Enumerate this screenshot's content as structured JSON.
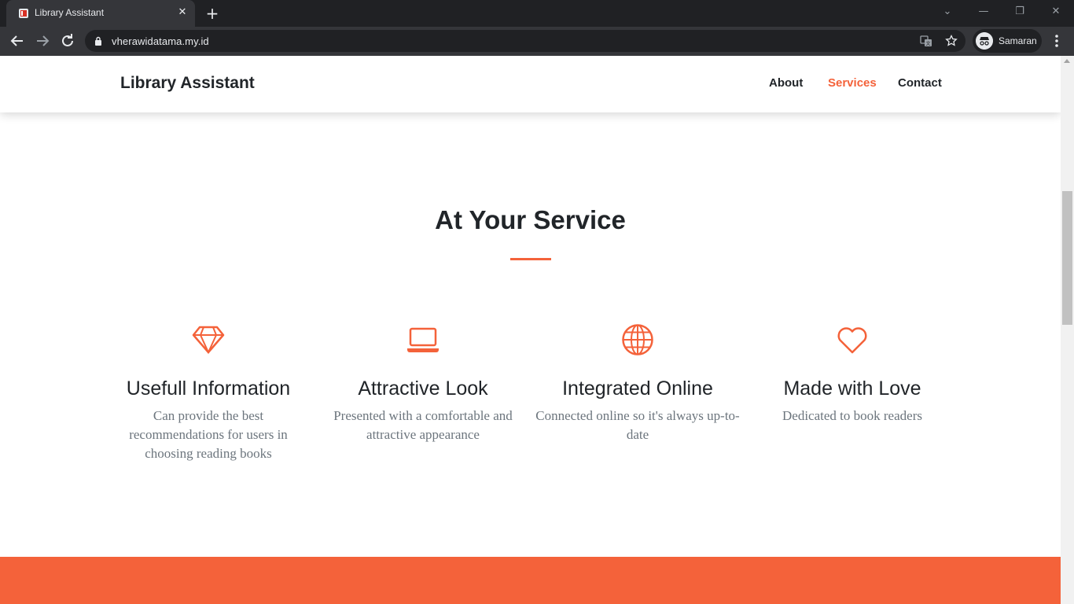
{
  "browser": {
    "tab_title": "Library Assistant",
    "tab_close": "✕",
    "new_tab": "+",
    "url": "vherawidatama.my.id",
    "profile_label": "Samaran",
    "window_controls": {
      "dropdown": "⌄",
      "minimize": "—",
      "restore": "❐",
      "close": "✕"
    }
  },
  "navbar": {
    "brand": "Library Assistant",
    "links": [
      {
        "label": "About",
        "active": false
      },
      {
        "label": "Services",
        "active": true
      },
      {
        "label": "Contact",
        "active": false
      }
    ]
  },
  "services": {
    "title": "At Your Service",
    "items": [
      {
        "icon": "gem-icon",
        "title": "Usefull Information",
        "desc": "Can provide the best recommendations for users in choosing reading books"
      },
      {
        "icon": "laptop-icon",
        "title": "Attractive Look",
        "desc": "Presented with a comfortable and attractive appearance"
      },
      {
        "icon": "globe-icon",
        "title": "Integrated Online",
        "desc": "Connected online so it's always up-to-date"
      },
      {
        "icon": "heart-icon",
        "title": "Made with Love",
        "desc": "Dedicated to book readers"
      }
    ]
  },
  "colors": {
    "accent": "#f4623a",
    "text": "#212529",
    "muted": "#6c757d",
    "chrome_dark": "#202124",
    "chrome_mid": "#35363a"
  }
}
